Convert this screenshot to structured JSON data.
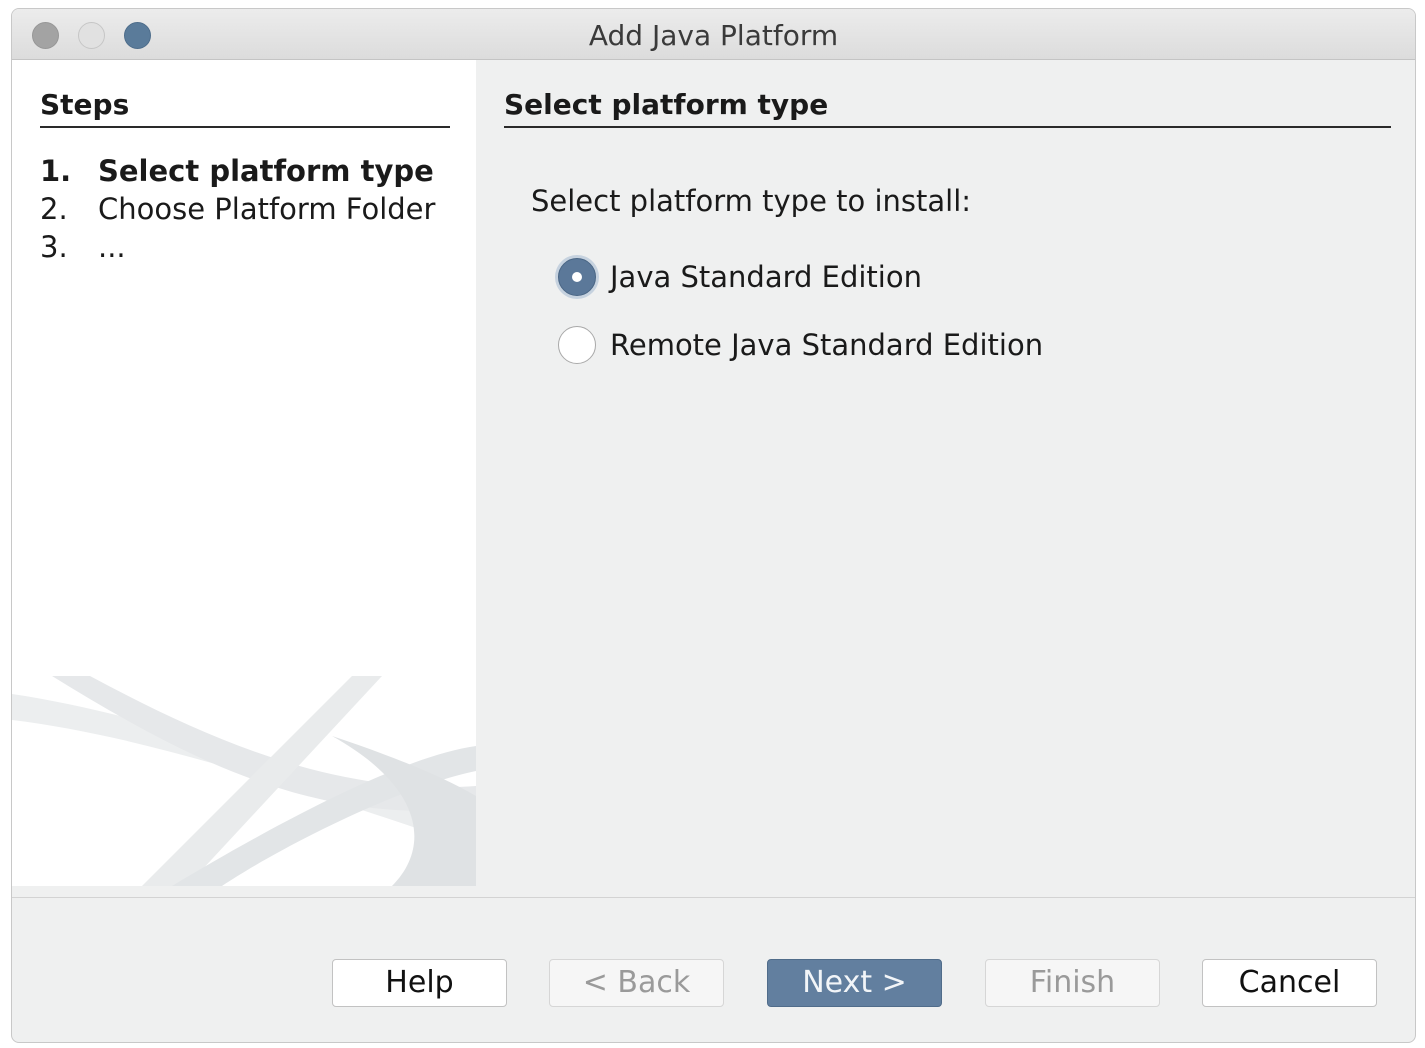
{
  "window": {
    "title": "Add Java Platform"
  },
  "steps": {
    "heading": "Steps",
    "items": [
      {
        "number": "1.",
        "label": "Select platform type",
        "current": true
      },
      {
        "number": "2.",
        "label": "Choose Platform Folder",
        "current": false
      },
      {
        "number": "3.",
        "label": "...",
        "current": false
      }
    ]
  },
  "panel": {
    "heading": "Select platform type",
    "prompt": "Select platform type to install:",
    "options": [
      {
        "label": "Java Standard Edition",
        "selected": true
      },
      {
        "label": "Remote Java Standard Edition",
        "selected": false
      }
    ]
  },
  "buttons": {
    "help": {
      "label": "Help",
      "enabled": true
    },
    "back": {
      "label": "< Back",
      "enabled": false
    },
    "next": {
      "label": "Next >",
      "enabled": true,
      "default": true
    },
    "finish": {
      "label": "Finish",
      "enabled": false
    },
    "cancel": {
      "label": "Cancel",
      "enabled": true
    }
  },
  "colors": {
    "accent": "#627f9f",
    "window_background": "#eff0f0",
    "steps_background": "#ffffff"
  }
}
